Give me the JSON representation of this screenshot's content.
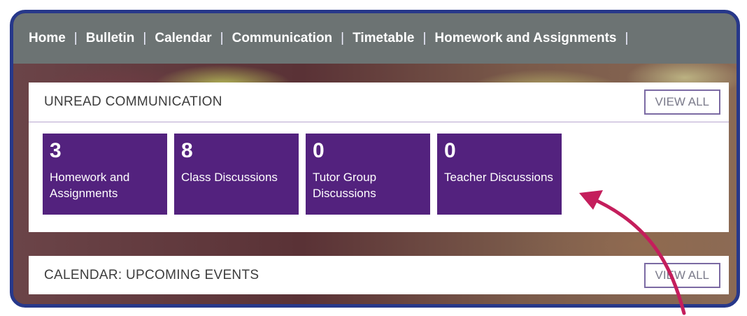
{
  "nav": {
    "items": [
      {
        "label": "Home"
      },
      {
        "label": "Bulletin"
      },
      {
        "label": "Calendar"
      },
      {
        "label": "Communication"
      },
      {
        "label": "Timetable"
      },
      {
        "label": "Homework and Assignments"
      }
    ],
    "separator": "|"
  },
  "unread": {
    "title": "UNREAD COMMUNICATION",
    "view_all": "VIEW ALL",
    "tiles": [
      {
        "count": "3",
        "label": "Homework and Assignments"
      },
      {
        "count": "8",
        "label": "Class Discussions"
      },
      {
        "count": "0",
        "label": "Tutor Group Discussions"
      },
      {
        "count": "0",
        "label": "Teacher Discussions"
      }
    ]
  },
  "calendar": {
    "title": "CALENDAR: UPCOMING EVENTS",
    "view_all": "VIEW ALL"
  },
  "colors": {
    "frame_border": "#27388a",
    "navbar": "#6c7373",
    "tile": "#53227e",
    "arrow": "#c41e5c"
  }
}
